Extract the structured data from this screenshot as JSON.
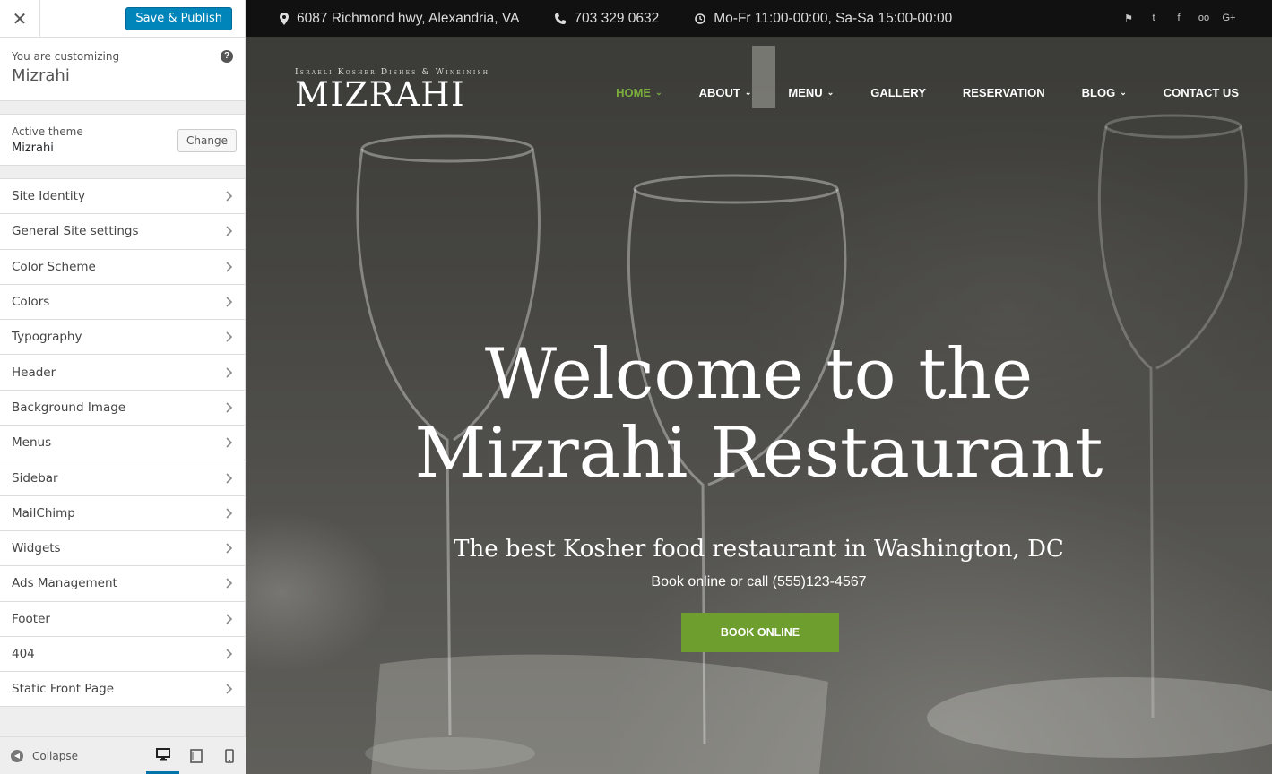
{
  "customizer": {
    "close_icon": "close-icon",
    "save_label": "Save & Publish",
    "customizing_label": "You are customizing",
    "site_name": "Mizrahi",
    "help_label": "?",
    "active_theme_label": "Active theme",
    "active_theme_name": "Mizrahi",
    "change_label": "Change",
    "sections": [
      {
        "label": "Site Identity"
      },
      {
        "label": "General Site settings"
      },
      {
        "label": "Color Scheme"
      },
      {
        "label": "Colors"
      },
      {
        "label": "Typography"
      },
      {
        "label": "Header"
      },
      {
        "label": "Background Image"
      },
      {
        "label": "Menus"
      },
      {
        "label": "Sidebar"
      },
      {
        "label": "MailChimp"
      },
      {
        "label": "Widgets"
      },
      {
        "label": "Ads Management"
      },
      {
        "label": "Footer"
      },
      {
        "label": "404"
      },
      {
        "label": "Static Front Page"
      }
    ],
    "collapse_label": "Collapse",
    "devices": [
      "desktop-icon",
      "tablet-icon",
      "mobile-icon"
    ],
    "active_device": "desktop"
  },
  "site": {
    "topbar": {
      "address": "6087 Richmond hwy, Alexandria, VA",
      "phone": "703 329 0632",
      "hours": "Mo-Fr 11:00-00:00, Sa-Sa 15:00-00:00",
      "social": [
        "foursquare-icon",
        "twitter-icon",
        "facebook-icon",
        "tripadvisor-icon",
        "google-plus-icon"
      ],
      "social_glyphs": [
        "⚑",
        "t",
        "f",
        "oo",
        "G+"
      ]
    },
    "logo": {
      "tagline": "Israeli Kosher Dishes & Wineinish",
      "name": "MIZRAHI"
    },
    "nav": [
      {
        "label": "HOME",
        "dropdown": true,
        "active": true
      },
      {
        "label": "ABOUT",
        "dropdown": true
      },
      {
        "label": "MENU",
        "dropdown": true
      },
      {
        "label": "GALLERY"
      },
      {
        "label": "RESERVATION"
      },
      {
        "label": "BLOG",
        "dropdown": true
      },
      {
        "label": "CONTACT US"
      }
    ],
    "hero": {
      "headline_line1": "Welcome to the",
      "headline_line2": "Mizrahi Restaurant",
      "subheadline": "The best Kosher food restaurant in Washington, DC",
      "book_text": "Book online or call (555)123-4567",
      "button_label": "BOOK ONLINE"
    },
    "colors": {
      "accent_green": "#7aae3c",
      "button_green": "#6e9e2d",
      "wp_blue": "#0085ba",
      "topbar_bg": "#111111"
    }
  }
}
